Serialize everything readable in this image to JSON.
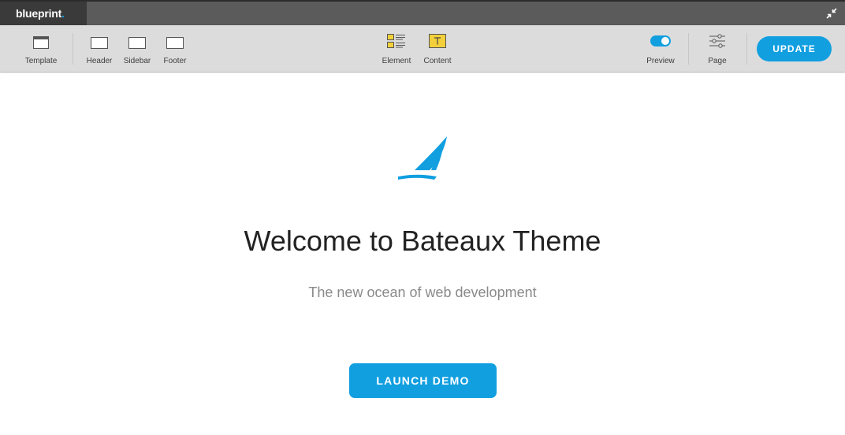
{
  "app": {
    "logo_text": "blueprint",
    "logo_dot": ".",
    "accent_color": "#11a0e0"
  },
  "toolbar": {
    "left_items": [
      {
        "label": "Template",
        "icon": "template-icon"
      },
      {
        "label": "Header",
        "icon": "header-icon"
      },
      {
        "label": "Sidebar",
        "icon": "sidebar-icon"
      },
      {
        "label": "Footer",
        "icon": "footer-icon"
      }
    ],
    "center_items": [
      {
        "label": "Element",
        "icon": "element-icon"
      },
      {
        "label": "Content",
        "icon": "content-icon"
      }
    ],
    "right_items": [
      {
        "label": "Preview",
        "icon": "toggle-icon",
        "state": "on"
      },
      {
        "label": "Page",
        "icon": "sliders-icon"
      }
    ],
    "update_label": "UPDATE"
  },
  "main": {
    "logo_icon": "sailboat-icon",
    "title": "Welcome to Bateaux Theme",
    "subtitle": "The new ocean of web development",
    "cta_label": "LAUNCH DEMO"
  }
}
